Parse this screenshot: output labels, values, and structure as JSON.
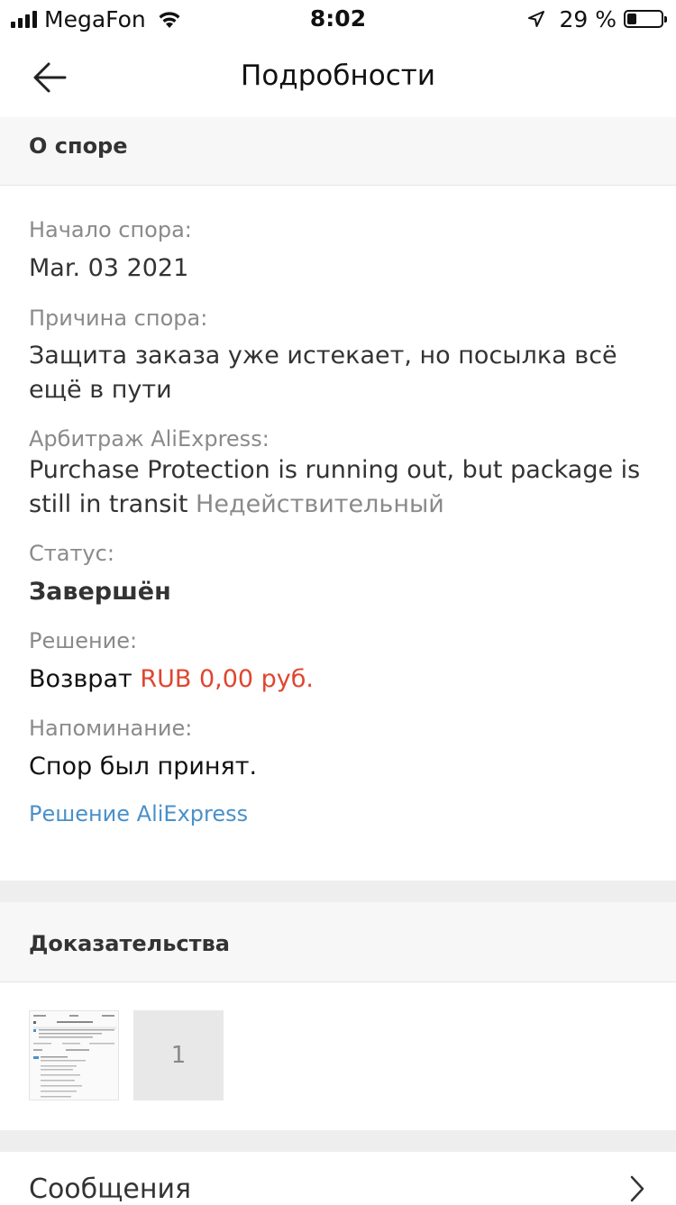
{
  "status_bar": {
    "carrier": "MegaFon",
    "time": "8:02",
    "battery": "29 %",
    "battery_level": 0.29
  },
  "header": {
    "title": "Подробности",
    "back_icon": "arrow-left-icon"
  },
  "dispute": {
    "section_title": "О споре",
    "start_label": "Начало спора:",
    "start_value": "Mar. 03 2021",
    "reason_label": "Причина спора:",
    "reason_value": "Защита заказа уже истекает, но посылка всё ещё в пути",
    "arbitration_label": "Арбитраж AliExpress:",
    "arbitration_value": "Purchase Protection is running out, but package is still in transit",
    "arbitration_status": "Недействительный",
    "status_label": "Статус:",
    "status_value": "Завершён",
    "decision_label": "Решение:",
    "decision_prefix": "Возврат",
    "decision_amount": "RUB 0,00 руб.",
    "reminder_label": "Напоминание:",
    "reminder_value": "Спор был принят.",
    "link_text": "Решение AliExpress"
  },
  "evidence": {
    "section_title": "Доказательства",
    "more_count": "1"
  },
  "messages": {
    "label": "Сообщения",
    "chevron_icon": "chevron-right-icon"
  },
  "colors": {
    "accent_red": "#e0452f",
    "link_blue": "#4a90c9",
    "muted_gray": "#8a8a8a",
    "section_bg": "#f7f7f7"
  }
}
